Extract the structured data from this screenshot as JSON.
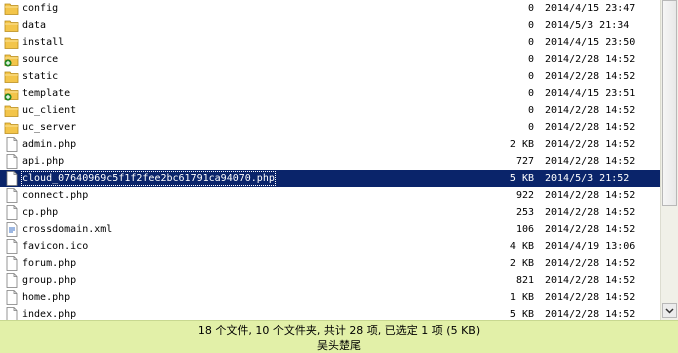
{
  "files": [
    {
      "name": "config",
      "size": "0",
      "date": "2014/4/15 23:47",
      "icon": "folder-icon"
    },
    {
      "name": "data",
      "size": "0",
      "date": "2014/5/3 21:34",
      "icon": "folder-icon"
    },
    {
      "name": "install",
      "size": "0",
      "date": "2014/4/15 23:50",
      "icon": "folder-icon"
    },
    {
      "name": "source",
      "size": "0",
      "date": "2014/2/28 14:52",
      "icon": "folder-plus-icon"
    },
    {
      "name": "static",
      "size": "0",
      "date": "2014/2/28 14:52",
      "icon": "folder-icon"
    },
    {
      "name": "template",
      "size": "0",
      "date": "2014/4/15 23:51",
      "icon": "folder-plus-icon"
    },
    {
      "name": "uc_client",
      "size": "0",
      "date": "2014/2/28 14:52",
      "icon": "folder-icon"
    },
    {
      "name": "uc_server",
      "size": "0",
      "date": "2014/2/28 14:52",
      "icon": "folder-icon"
    },
    {
      "name": "admin.php",
      "size": "2 KB",
      "date": "2014/2/28 14:52",
      "icon": "file-icon"
    },
    {
      "name": "api.php",
      "size": "727",
      "date": "2014/2/28 14:52",
      "icon": "file-icon"
    },
    {
      "name": "cloud_07640969c5f1f2fee2bc61791ca94070.php",
      "size": "5 KB",
      "date": "2014/5/3 21:52",
      "icon": "file-icon",
      "selected": true
    },
    {
      "name": "connect.php",
      "size": "922",
      "date": "2014/2/28 14:52",
      "icon": "file-icon"
    },
    {
      "name": "cp.php",
      "size": "253",
      "date": "2014/2/28 14:52",
      "icon": "file-icon"
    },
    {
      "name": "crossdomain.xml",
      "size": "106",
      "date": "2014/2/28 14:52",
      "icon": "xml-file-icon"
    },
    {
      "name": "favicon.ico",
      "size": "4 KB",
      "date": "2014/4/19 13:06",
      "icon": "file-icon"
    },
    {
      "name": "forum.php",
      "size": "2 KB",
      "date": "2014/2/28 14:52",
      "icon": "file-icon"
    },
    {
      "name": "group.php",
      "size": "821",
      "date": "2014/2/28 14:52",
      "icon": "file-icon"
    },
    {
      "name": "home.php",
      "size": "1 KB",
      "date": "2014/2/28 14:52",
      "icon": "file-icon"
    },
    {
      "name": "index.php",
      "size": "5 KB",
      "date": "2014/2/28 14:52",
      "icon": "file-icon"
    }
  ],
  "status": {
    "summary": "18 个文件, 10 个文件夹, 共计 28 项, 已选定 1 项 (5 KB)",
    "author": "吴头楚尾"
  },
  "colors": {
    "selection": "#0a246a",
    "status_bg": "#e2f0a8",
    "folder": "#f3c54a"
  }
}
